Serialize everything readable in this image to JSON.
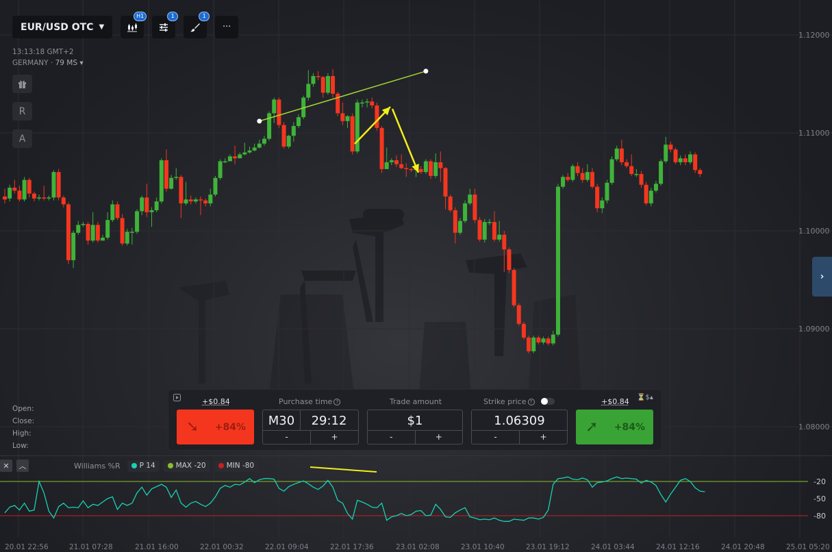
{
  "toolbar": {
    "pair": "EUR/USD OTC",
    "timeframe_badge": "H1",
    "indicators_badge": "1",
    "drawings_badge": "1",
    "more_label": "···"
  },
  "info": {
    "time": "13:13:18 GMT+2",
    "region": "GERMANY",
    "latency": "79 MS"
  },
  "side_buttons": {
    "r": "R",
    "a": "A"
  },
  "ohlc": {
    "open": "Open:",
    "close": "Close:",
    "high": "High:",
    "low": "Low:"
  },
  "trade": {
    "payout_sell": "+$0.84",
    "payout_buy": "+$0.84",
    "sell_pct": "+84%",
    "buy_pct": "+84%",
    "purchase_time_label": "Purchase time",
    "timeframe": "M30",
    "time_value": "29:12",
    "amount_label": "Trade amount",
    "amount_value": "$1",
    "strike_label": "Strike price",
    "strike_value": "1.06309",
    "minus": "-",
    "plus": "+"
  },
  "oscillator": {
    "name": "Williams %R",
    "period": "P 14",
    "max": "MAX -20",
    "min": "MIN -80",
    "colors": {
      "line": "#17d3b4",
      "max": "#8bbf2a",
      "min": "#c62020"
    }
  },
  "chart_data": {
    "type": "candlestick",
    "price_axis_ticks": [
      "1.12000",
      "1.11000",
      "1.10000",
      "1.09000",
      "1.08000"
    ],
    "oscillator_ticks": [
      "-20",
      "-50",
      "-80"
    ],
    "x_tick_labels": [
      "20.01 22:56",
      "21.01 07:28",
      "21.01 16:00",
      "22.01 00:32",
      "22.01 09:04",
      "22.01 17:36",
      "23.01 02:08",
      "23.01 10:40",
      "23.01 19:12",
      "24.01 03:44",
      "24.01 12:16",
      "24.01 20:48",
      "25.01 05:20"
    ],
    "colors": {
      "up": "#3fb33a",
      "down": "#f5361f"
    },
    "candles": [
      [
        1.1035,
        1.1032,
        1.1043,
        1.1028
      ],
      [
        1.1033,
        1.1044,
        1.1047,
        1.103
      ],
      [
        1.1044,
        1.1041,
        1.1052,
        1.1038
      ],
      [
        1.1041,
        1.1032,
        1.1046,
        1.103
      ],
      [
        1.1032,
        1.1052,
        1.1055,
        1.103
      ],
      [
        1.1052,
        1.1038,
        1.1054,
        1.1034
      ],
      [
        1.1038,
        1.1033,
        1.104,
        1.103
      ],
      [
        1.1033,
        1.1034,
        1.1037,
        1.1031
      ],
      [
        1.1034,
        1.1033,
        1.1046,
        1.1031
      ],
      [
        1.1033,
        1.1034,
        1.1036,
        1.1031
      ],
      [
        1.1034,
        1.106,
        1.1062,
        1.1031
      ],
      [
        1.106,
        1.1034,
        1.1063,
        1.1031
      ],
      [
        1.1034,
        1.1027,
        1.1036,
        1.1024
      ],
      [
        1.1027,
        1.097,
        1.1029,
        1.0966
      ],
      [
        1.097,
        1.0998,
        1.1,
        1.0962
      ],
      [
        1.0998,
        1.1006,
        1.101,
        1.0996
      ],
      [
        1.1006,
        1.1007,
        1.1009,
        1.1004
      ],
      [
        1.1007,
        1.099,
        1.1009,
        1.0986
      ],
      [
        1.099,
        1.1006,
        1.1019,
        1.0988
      ],
      [
        1.1006,
        1.099,
        1.1009,
        1.0988
      ],
      [
        1.099,
        1.0993,
        1.0996,
        1.099
      ],
      [
        1.0993,
        1.1011,
        1.1019,
        1.0991
      ],
      [
        1.1011,
        1.1027,
        1.1031,
        1.1009
      ],
      [
        1.1027,
        1.1013,
        1.103,
        1.1011
      ],
      [
        1.1013,
        1.0987,
        1.1017,
        1.0985
      ],
      [
        1.0987,
        1.0999,
        1.1002,
        1.0985
      ],
      [
        1.0999,
        1.0999,
        1.1003,
        1.0986
      ],
      [
        1.0999,
        1.102,
        1.1022,
        1.0997
      ],
      [
        1.102,
        1.1034,
        1.1036,
        1.1016
      ],
      [
        1.1034,
        1.1019,
        1.1048,
        1.1014
      ],
      [
        1.1019,
        1.1021,
        1.1024,
        1.1004
      ],
      [
        1.1021,
        1.103,
        1.1034,
        1.1019
      ],
      [
        1.103,
        1.1072,
        1.1074,
        1.1028
      ],
      [
        1.1072,
        1.1043,
        1.1083,
        1.104
      ],
      [
        1.1043,
        1.1054,
        1.1057,
        1.1042
      ],
      [
        1.1054,
        1.1055,
        1.1064,
        1.1052
      ],
      [
        1.1055,
        1.1028,
        1.1057,
        1.1013
      ],
      [
        1.1028,
        1.1032,
        1.105,
        1.1026
      ],
      [
        1.1032,
        1.103,
        1.1036,
        1.1027
      ],
      [
        1.103,
        1.1032,
        1.1034,
        1.1028
      ],
      [
        1.1032,
        1.1031,
        1.1035,
        1.1016
      ],
      [
        1.1031,
        1.1028,
        1.1033,
        1.1025
      ],
      [
        1.1028,
        1.1037,
        1.1043,
        1.1025
      ],
      [
        1.1037,
        1.1054,
        1.1056,
        1.1035
      ],
      [
        1.1054,
        1.1071,
        1.1073,
        1.1052
      ],
      [
        1.1071,
        1.1071,
        1.1074,
        1.1069
      ],
      [
        1.1071,
        1.1076,
        1.1078,
        1.1074
      ],
      [
        1.1076,
        1.1074,
        1.1087,
        1.1068
      ],
      [
        1.1074,
        1.1078,
        1.108,
        1.1076
      ],
      [
        1.1078,
        1.108,
        1.109,
        1.1077
      ],
      [
        1.108,
        1.1082,
        1.1086,
        1.1079
      ],
      [
        1.1082,
        1.1085,
        1.1089,
        1.1081
      ],
      [
        1.1085,
        1.1089,
        1.1093,
        1.1084
      ],
      [
        1.1089,
        1.1094,
        1.1097,
        1.1087
      ],
      [
        1.1094,
        1.112,
        1.1122,
        1.1092
      ],
      [
        1.112,
        1.1134,
        1.1136,
        1.111
      ],
      [
        1.1134,
        1.1108,
        1.1136,
        1.1105
      ],
      [
        1.1108,
        1.1086,
        1.1111,
        1.1084
      ],
      [
        1.1086,
        1.1097,
        1.1098,
        1.1084
      ],
      [
        1.1097,
        1.1107,
        1.1111,
        1.1091
      ],
      [
        1.1107,
        1.1116,
        1.1119,
        1.1105
      ],
      [
        1.1116,
        1.1136,
        1.1138,
        1.1114
      ],
      [
        1.1136,
        1.115,
        1.1164,
        1.1133
      ],
      [
        1.115,
        1.1158,
        1.1161,
        1.1147
      ],
      [
        1.1158,
        1.1157,
        1.1163,
        1.1154
      ],
      [
        1.1157,
        1.1141,
        1.1158,
        1.1136
      ],
      [
        1.1141,
        1.1158,
        1.1161,
        1.1139
      ],
      [
        1.1158,
        1.114,
        1.1165,
        1.1136
      ],
      [
        1.114,
        1.112,
        1.1142,
        1.1117
      ],
      [
        1.112,
        1.1112,
        1.1131,
        1.1108
      ],
      [
        1.1112,
        1.1117,
        1.1118,
        1.1105
      ],
      [
        1.1117,
        1.1081,
        1.112,
        1.1078
      ],
      [
        1.1081,
        1.1131,
        1.1134,
        1.1079
      ],
      [
        1.1131,
        1.1131,
        1.1134,
        1.1126
      ],
      [
        1.1131,
        1.1132,
        1.1135,
        1.1126
      ],
      [
        1.1132,
        1.1128,
        1.1136,
        1.1125
      ],
      [
        1.1128,
        1.1105,
        1.1131,
        1.1102
      ],
      [
        1.1105,
        1.1063,
        1.1107,
        1.1059
      ],
      [
        1.1063,
        1.107,
        1.1085,
        1.1067
      ],
      [
        1.107,
        1.1072,
        1.1074,
        1.1067
      ],
      [
        1.1072,
        1.1068,
        1.1077,
        1.1065
      ],
      [
        1.1068,
        1.1064,
        1.1078,
        1.1063
      ],
      [
        1.1064,
        1.1063,
        1.1069,
        1.1055
      ],
      [
        1.1063,
        1.1062,
        1.1064,
        1.106
      ],
      [
        1.1062,
        1.1063,
        1.1067,
        1.1055
      ],
      [
        1.1063,
        1.106,
        1.1066,
        1.1058
      ],
      [
        1.106,
        1.1071,
        1.1073,
        1.1058
      ],
      [
        1.1071,
        1.1056,
        1.1073,
        1.1053
      ],
      [
        1.1056,
        1.107,
        1.1079,
        1.1054
      ],
      [
        1.107,
        1.1064,
        1.1081,
        1.105
      ],
      [
        1.1064,
        1.1035,
        1.1065,
        1.1022
      ],
      [
        1.1035,
        1.1021,
        1.1037,
        1.1019
      ],
      [
        1.1021,
        1.0998,
        1.1024,
        1.0987
      ],
      [
        1.0998,
        1.101,
        1.1013,
        1.0996
      ],
      [
        1.101,
        1.1028,
        1.1031,
        1.1008
      ],
      [
        1.1028,
        1.1037,
        1.1043,
        1.1026
      ],
      [
        1.1037,
        1.1011,
        1.1043,
        1.1008
      ],
      [
        1.1011,
        1.0991,
        1.1014,
        1.0989
      ],
      [
        1.0991,
        1.1009,
        1.1012,
        1.0988
      ],
      [
        1.1009,
        1.1009,
        1.1012,
        1.1006
      ],
      [
        1.1009,
        1.0991,
        1.102,
        1.0989
      ],
      [
        1.0991,
        1.0996,
        1.101,
        1.0989
      ],
      [
        1.0996,
        1.0981,
        1.1,
        1.0958
      ],
      [
        1.0981,
        1.096,
        1.0983,
        1.0957
      ],
      [
        1.096,
        1.0924,
        1.0962,
        1.0922
      ],
      [
        1.0924,
        1.0905,
        1.0926,
        1.0903
      ],
      [
        1.0905,
        1.0891,
        1.0907,
        1.0889
      ],
      [
        1.0891,
        1.0877,
        1.0893,
        1.0875
      ],
      [
        1.0877,
        1.0891,
        1.0893,
        1.0875
      ],
      [
        1.0891,
        1.0886,
        1.0893,
        1.0884
      ],
      [
        1.0886,
        1.089,
        1.0892,
        1.0884
      ],
      [
        1.089,
        1.0885,
        1.0892,
        1.0883
      ],
      [
        1.0885,
        1.0894,
        1.0898,
        1.0883
      ],
      [
        1.0894,
        1.1045,
        1.1048,
        1.0892
      ],
      [
        1.1045,
        1.1055,
        1.1057,
        1.1043
      ],
      [
        1.1055,
        1.1052,
        1.1059,
        1.105
      ],
      [
        1.1052,
        1.1066,
        1.1068,
        1.105
      ],
      [
        1.1066,
        1.1059,
        1.107,
        1.1056
      ],
      [
        1.1059,
        1.1052,
        1.1064,
        1.1049
      ],
      [
        1.1052,
        1.106,
        1.1068,
        1.105
      ],
      [
        1.106,
        1.1045,
        1.1064,
        1.1043
      ],
      [
        1.1045,
        1.1023,
        1.1048,
        1.1019
      ],
      [
        1.1023,
        1.1031,
        1.1034,
        1.1018
      ],
      [
        1.1031,
        1.1049,
        1.1052,
        1.1028
      ],
      [
        1.1049,
        1.1073,
        1.1076,
        1.1047
      ],
      [
        1.1073,
        1.1084,
        1.1087,
        1.1071
      ],
      [
        1.1084,
        1.107,
        1.1093,
        1.1067
      ],
      [
        1.107,
        1.1066,
        1.1073,
        1.1064
      ],
      [
        1.1066,
        1.1058,
        1.1078,
        1.1056
      ],
      [
        1.1058,
        1.1058,
        1.1063,
        1.1055
      ],
      [
        1.1058,
        1.1047,
        1.1061,
        1.1044
      ],
      [
        1.1047,
        1.1028,
        1.105,
        1.1026
      ],
      [
        1.1028,
        1.1041,
        1.1044,
        1.1025
      ],
      [
        1.1041,
        1.1048,
        1.1051,
        1.1039
      ],
      [
        1.1048,
        1.1071,
        1.1073,
        1.1046
      ],
      [
        1.1071,
        1.1088,
        1.1096,
        1.1069
      ],
      [
        1.1088,
        1.1083,
        1.1091,
        1.108
      ],
      [
        1.1083,
        1.107,
        1.1085,
        1.1068
      ],
      [
        1.107,
        1.1074,
        1.1077,
        1.1067
      ],
      [
        1.1074,
        1.107,
        1.1078,
        1.1067
      ],
      [
        1.107,
        1.1078,
        1.1081,
        1.1068
      ],
      [
        1.1078,
        1.1062,
        1.108,
        1.1059
      ],
      [
        1.1062,
        1.1058,
        1.1064,
        1.1055
      ]
    ],
    "williams_r": [
      -75,
      -65,
      -62,
      -70,
      -58,
      -72,
      -70,
      -20,
      -40,
      -72,
      -84,
      -64,
      -58,
      -66,
      -65,
      -66,
      -54,
      -66,
      -60,
      -62,
      -56,
      -50,
      -47,
      -69,
      -58,
      -62,
      -58,
      -40,
      -30,
      -44,
      -33,
      -29,
      -25,
      -30,
      -48,
      -35,
      -58,
      -65,
      -58,
      -55,
      -60,
      -64,
      -58,
      -47,
      -32,
      -27,
      -30,
      -25,
      -26,
      -21,
      -15,
      -22,
      -17,
      -15,
      -15,
      -16,
      -32,
      -37,
      -29,
      -25,
      -22,
      -19,
      -24,
      -30,
      -34,
      -28,
      -18,
      -30,
      -53,
      -58,
      -76,
      -86,
      -53,
      -56,
      -60,
      -65,
      -66,
      -58,
      -88,
      -82,
      -80,
      -76,
      -80,
      -78,
      -72,
      -71,
      -80,
      -79,
      -60,
      -69,
      -82,
      -83,
      -75,
      -70,
      -66,
      -82,
      -84,
      -87,
      -86,
      -87,
      -84,
      -88,
      -90,
      -90,
      -86,
      -87,
      -88,
      -84,
      -84,
      -86,
      -83,
      -70,
      -25,
      -15,
      -14,
      -12,
      -16,
      -17,
      -14,
      -17,
      -30,
      -22,
      -21,
      -19,
      -15,
      -12,
      -15,
      -14,
      -15,
      -16,
      -23,
      -18,
      -21,
      -27,
      -43,
      -56,
      -42,
      -30,
      -18,
      -15,
      -20,
      -31,
      -37,
      -38
    ]
  },
  "annotations": {
    "trendline_color": "#a5d636",
    "arrow_color": "#f2ef1a",
    "osc_trendline_color": "#f2ef1a"
  }
}
